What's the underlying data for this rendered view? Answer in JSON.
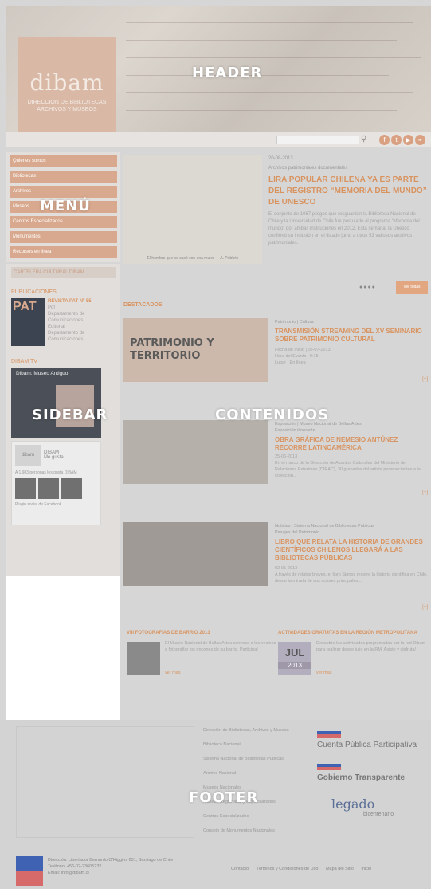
{
  "labels": {
    "header": "HEADER",
    "menu": "MENÚ",
    "sidebar": "SIDEBAR",
    "content": "CONTENIDOS",
    "footer": "FOOTER"
  },
  "header": {
    "logo_word": "dibam",
    "logo_sub_1": "DIRECCIÓN DE BIBLIOTECAS",
    "logo_sub_2": "ARCHIVOS Y MUSEOS",
    "social_icons": [
      "facebook-icon",
      "twitter-icon",
      "youtube-icon",
      "rss-icon"
    ],
    "accent": "#d9935f"
  },
  "menu": {
    "items": [
      "Quiénes somos",
      "Bibliotecas",
      "Archivos",
      "Museos",
      "Centros Especializados",
      "Monumentos",
      "Recursos en línea"
    ]
  },
  "sidebar": {
    "cartelera": "CARTELERA CULTURAL DIBAM",
    "pub_section": "PUBLICACIONES",
    "pub_cover": "PAT",
    "pub_title": "REVISTA PAT Nº 55",
    "pub_line1": "Pdf",
    "pub_line2": "Departamento de",
    "pub_line3": "Comunicaciones",
    "pub_line4": "Editorial",
    "pub_line5": "Departamento de",
    "pub_line6": "Comunicaciones",
    "video_section": "DIBAM TV",
    "video_title": "Dibam: Museo Antiguo",
    "fb_name": "DIBAM",
    "fb_logo": "dibam",
    "fb_like": "Me gusta",
    "fb_count": "A 1.983 personas les gusta DIBAM",
    "fb_plugin": "Plugin social de Facebook"
  },
  "content": {
    "slide_date": "20-08-2013",
    "slide_category": "Archivos patrimoniales documentales",
    "slide_title": "LIRA POPULAR CHILENA YA ES PARTE DEL REGISTRO “MEMORIA DEL MUNDO” DE UNESCO",
    "slide_text": "El conjunto de 1067 pliegos que resguardan la Biblioteca Nacional de Chile y la Universidad de Chile fue postulado al programa “Memoria del mundo” por ambas instituciones en 2012. Esta semana, la Unesco confirmó su inclusión en el listado junto a otros 53 valiosos archivos patrimoniales.",
    "slide_caption": "El hombre que se casó con una mujer — A. Poblete",
    "dots": "●●●●",
    "more_button": "Ver todas",
    "destacados": "DESTACADOS",
    "news": [
      {
        "meta": "Patrimonio | Cultura",
        "title": "TRANSMISIÓN STREAMING DEL XV SEMINARIO SOBRE PATRIMONIO CULTURAL",
        "text": "Fecha de inicio | 05-07-2013\nHora del Evento | 9:15\nLugar | En línea",
        "image_text": "PATRIMONIO Y TERRITORIO"
      },
      {
        "meta": "Exposición | Museo Nacional de Bellas Artes",
        "sub": "Exposición itinerante",
        "title": "OBRA GRÁFICA DE NEMESIO ANTÚNEZ RECORRE LATINOAMÉRICA",
        "text": "25-06-2013\nEn el marco de la Dirección de Asuntos Culturales del Ministerio de Relaciones Exteriores (DIRAC), 30 grabados del artista pertenecientes a la colección..."
      },
      {
        "meta": "Noticias | Sistema Nacional de Bibliotecas Públicas",
        "sub": "Pasajes del Patrimonio",
        "title": "LIBRO QUE RELATA LA HISTORIA DE GRANDES CIENTÍFICOS CHILENOS LLEGARÁ A LAS BIBLIOTECAS PÚBLICAS",
        "text": "02-05-2013\nA través de relatos breves, el libro Signos recorre la historia científica en Chile, desde la mirada de sus actores principales..."
      }
    ],
    "arrow": "[+]",
    "mini_left_head": "VIII FOTOGRAFÍAS DE BARRIO 2013",
    "mini_left_text": "El Museo Nacional de Bellas Artes convoca a los vecinos a fotografiar los rincones de su barrio. Participa!",
    "mini_left_link": "ver más",
    "mini_right_head": "ACTIVIDADES GRATUITAS EN LA REGIÓN METROPOLITANA",
    "mini_right_text": "Descubre las actividades programadas por la red Dibam para realizar desde julio en la RM. Asiste y disfruta!",
    "mini_right_link": "ver más",
    "mini_right_month": "JUL",
    "mini_right_year": "2013"
  },
  "footer": {
    "links": [
      "Dirección de Bibliotecas, Archivos y Museos",
      "Biblioteca Nacional",
      "Sistema Nacional de Bibliotecas Públicas",
      "Archivo Nacional",
      "Museos Nacionales",
      "Museos Regionales y Especializados",
      "Centros Especializados",
      "Consejo de Monumentos Nacionales"
    ],
    "logo_1": "Cuenta Pública Participativa",
    "logo_2": "Gobierno Transparente",
    "legado": "legado",
    "legado_sub": "bicentenario",
    "address_1": "Dirección: Libertador Bernardo O'Higgins 651, Santiago de Chile",
    "address_2": "Teléfono: +56-02-23605232",
    "address_3": "Email: info@dibam.cl",
    "bottom_links": [
      "Contacto",
      "Términos y Condiciones de Uso",
      "Mapa del Sitio",
      "Inicio"
    ]
  }
}
